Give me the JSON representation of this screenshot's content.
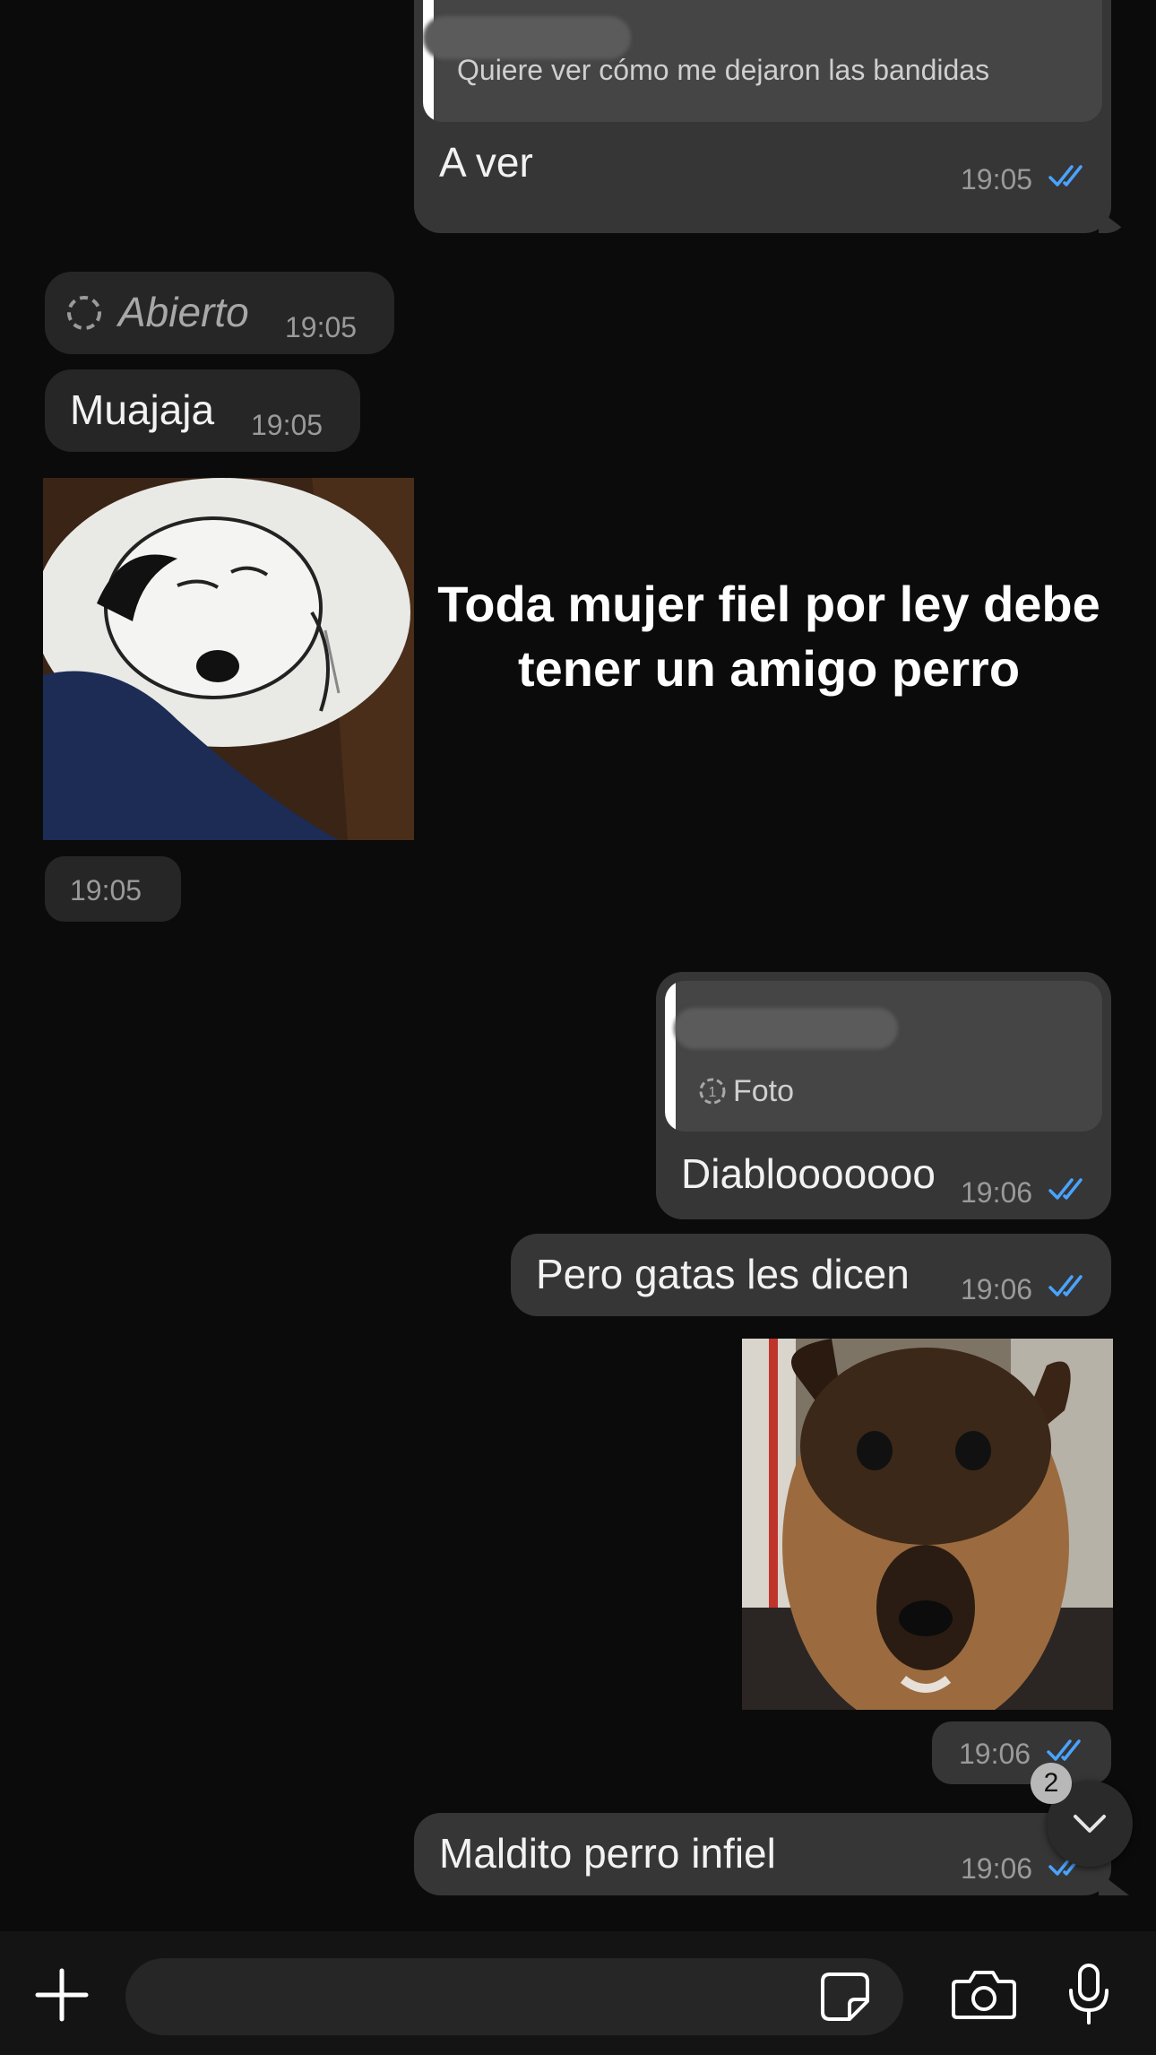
{
  "messages": {
    "m1": {
      "quote": "Quiere ver cómo me dejaron las bandidas",
      "text": "A ver",
      "time": "19:05"
    },
    "m2": {
      "status": "Abierto",
      "time": "19:05"
    },
    "m3": {
      "text": "Muajaja",
      "time": "19:05"
    },
    "m4": {
      "caption": "Toda mujer fiel por ley debe tener un amigo perro",
      "time": "19:05"
    },
    "m5": {
      "quote": "Foto",
      "text": "Diablooooooo",
      "time": "19:06"
    },
    "m6": {
      "text": "Pero gatas les dicen",
      "time": "19:06"
    },
    "m7": {
      "time": "19:06"
    },
    "m8": {
      "text": "Maldito perro infiel",
      "time": "19:06"
    }
  },
  "scroll_button": {
    "badge": "2"
  },
  "composer": {
    "placeholder": ""
  },
  "colors": {
    "read_ticks": "#4aa3ff",
    "outgoing": "#363636",
    "incoming": "#262626"
  }
}
